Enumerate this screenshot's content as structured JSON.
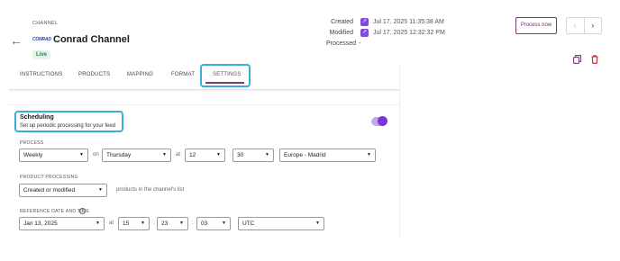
{
  "header": {
    "channel_caption": "CHANNEL",
    "brand_logo_text": "CONRAD",
    "channel_name": "Conrad Channel",
    "status": "Live",
    "back_icon": "arrow-left-icon"
  },
  "meta": {
    "created_label": "Created",
    "created_value": "Jul 17, 2025 11:35:38 AM",
    "modified_label": "Modified",
    "modified_value": "Jul 17, 2025 12:32:32 PM",
    "processed_label": "Processed",
    "processed_value": "-"
  },
  "actions": {
    "process_now": "Process now",
    "prev_glyph": "‹",
    "next_glyph": "›",
    "copy_icon": "copy-icon",
    "delete_icon": "trash-icon"
  },
  "tabs": [
    {
      "label": "INSTRUCTIONS"
    },
    {
      "label": "PRODUCTS"
    },
    {
      "label": "MAPPING"
    },
    {
      "label": "FORMAT"
    },
    {
      "label": "SETTINGS",
      "active": true
    }
  ],
  "scheduling": {
    "title": "Scheduling",
    "subtitle": "Set up periodic processing for your feed",
    "enabled": true,
    "process_label": "PROCESS",
    "frequency": "Weekly",
    "on_text": "on",
    "day": "Thursday",
    "at_text": "at",
    "hour": "12",
    "colon": ":",
    "minute": "30",
    "timezone": "Europe - Madrid",
    "product_processing_label": "PRODUCT PROCESSING",
    "product_processing": "Created or modified",
    "product_processing_suffix": "products in the channel's list",
    "reference_label": "REFERENCE DATE AND TIME",
    "help_glyph": "?",
    "ref_date": "Jan 13, 2025",
    "ref_at_text": "at",
    "ref_hour": "15",
    "ref_minute": "23",
    "ref_second": "03",
    "ref_timezone": "UTC"
  },
  "colors": {
    "accent": "#7b3c75",
    "toggle": "#7b35d9",
    "highlight": "#36b1d6",
    "live_bg": "#dff5e8",
    "live_fg": "#1f8a4c"
  }
}
